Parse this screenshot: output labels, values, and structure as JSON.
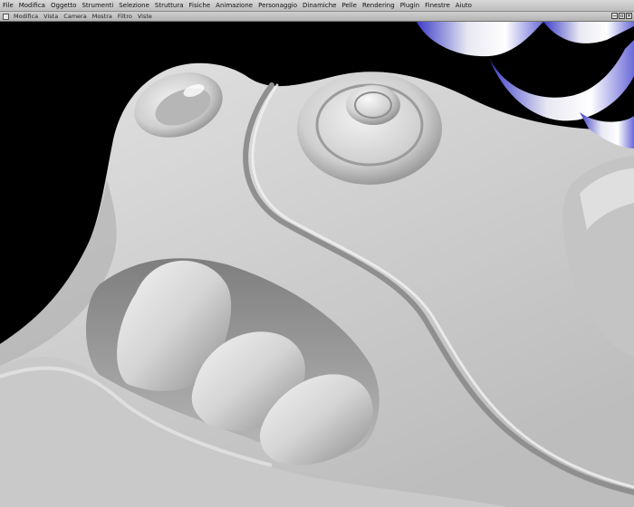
{
  "app": {
    "menu": [
      "File",
      "Modifica",
      "Oggetto",
      "Strumenti",
      "Selezione",
      "Struttura",
      "Fisiche",
      "Animazione",
      "Personaggio",
      "Dinamiche",
      "Pelle",
      "Rendering",
      "Plugin",
      "Finestre",
      "Aiuto"
    ],
    "panel_menu": [
      "Modifica",
      "Vista",
      "Camera",
      "Mostra",
      "Filtro",
      "Viste"
    ],
    "panel_controls": [
      "minimize-icon",
      "restore-icon",
      "close-icon"
    ]
  },
  "viewport": {
    "background": "#000000",
    "model_color": "#d6d6d6",
    "accent_color": "#5a5ad6"
  }
}
